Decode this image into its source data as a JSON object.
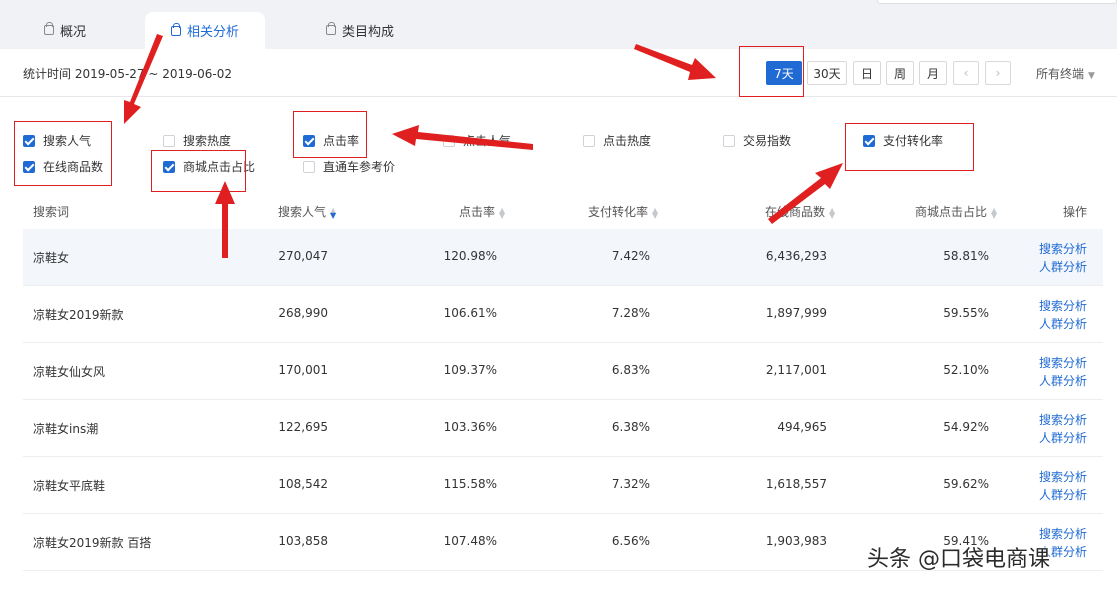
{
  "tabs": [
    {
      "label": "概况"
    },
    {
      "label": "相关分析"
    },
    {
      "label": "类目构成"
    }
  ],
  "date_bar": {
    "stat_time": "统计时间 2019-05-27 ~ 2019-06-02",
    "ranges": [
      "7天",
      "30天",
      "日",
      "周",
      "月"
    ],
    "active_range": "7天",
    "prev": "‹",
    "next": "›",
    "terminal": "所有终端"
  },
  "metrics": [
    {
      "label": "搜索人气",
      "checked": true
    },
    {
      "label": "在线商品数",
      "checked": true
    },
    {
      "label": "搜索热度",
      "checked": false
    },
    {
      "label": "商城点击占比",
      "checked": true
    },
    {
      "label": "点击率",
      "checked": true
    },
    {
      "label": "直通车参考价",
      "checked": false
    },
    {
      "label": "点击人气",
      "checked": false
    },
    {
      "label": "点击热度",
      "checked": false
    },
    {
      "label": "交易指数",
      "checked": false
    },
    {
      "label": "支付转化率",
      "checked": true
    }
  ],
  "table": {
    "headers": [
      "搜索词",
      "搜索人气",
      "点击率",
      "支付转化率",
      "在线商品数",
      "商城点击占比",
      "操作"
    ],
    "action_labels": [
      "搜索分析",
      "人群分析"
    ],
    "rows": [
      [
        "凉鞋女",
        "270,047",
        "120.98%",
        "7.42%",
        "6,436,293",
        "58.81%"
      ],
      [
        "凉鞋女2019新款",
        "268,990",
        "106.61%",
        "7.28%",
        "1,897,999",
        "59.55%"
      ],
      [
        "凉鞋女仙女风",
        "170,001",
        "109.37%",
        "6.83%",
        "2,117,001",
        "52.10%"
      ],
      [
        "凉鞋女ins潮",
        "122,695",
        "103.36%",
        "6.38%",
        "494,965",
        "54.92%"
      ],
      [
        "凉鞋女平底鞋",
        "108,542",
        "115.58%",
        "7.32%",
        "1,618,557",
        "59.62%"
      ],
      [
        "凉鞋女2019新款 百搭",
        "103,858",
        "107.48%",
        "6.56%",
        "1,903,983",
        "59.41%"
      ]
    ]
  },
  "watermark": "头条 @口袋电商课",
  "colors": {
    "accent": "#1f6ad3",
    "annotation": "#e02020"
  }
}
